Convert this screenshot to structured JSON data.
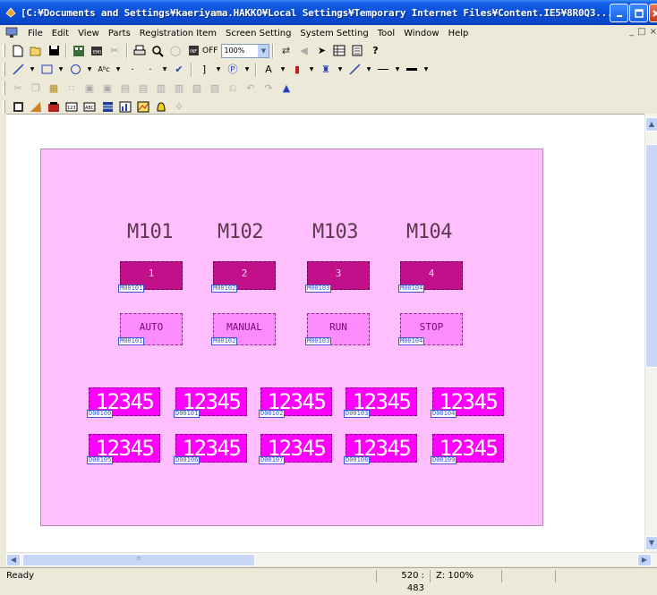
{
  "window": {
    "title": "[C:¥Documents and Settings¥kaeriyama.HAKKO¥Local Settings¥Temporary Internet Files¥Content.IE5¥8R0Q3..."
  },
  "menu": [
    "File",
    "Edit",
    "View",
    "Parts",
    "Registration Item",
    "Screen Setting",
    "System Setting",
    "Tool",
    "Window",
    "Help"
  ],
  "toolbar": {
    "grid_state": "OFF",
    "zoom_value": "100%"
  },
  "screen": {
    "bit_labels": [
      "M101",
      "M102",
      "M103",
      "M104"
    ],
    "lamps": [
      {
        "text": "1",
        "tag": "M00101"
      },
      {
        "text": "2",
        "tag": "M00102"
      },
      {
        "text": "3",
        "tag": "M00103"
      },
      {
        "text": "4",
        "tag": "M00104"
      }
    ],
    "switches": [
      {
        "text": "AUTO",
        "tag": "M00101"
      },
      {
        "text": "MANUAL",
        "tag": "M00102"
      },
      {
        "text": "RUN",
        "tag": "M00103"
      },
      {
        "text": "STOP",
        "tag": "M00104"
      }
    ],
    "numerals_row1": [
      {
        "value": "12345",
        "tag": "D00100"
      },
      {
        "value": "12345",
        "tag": "D00101"
      },
      {
        "value": "12345",
        "tag": "D00102"
      },
      {
        "value": "12345",
        "tag": "D00103"
      },
      {
        "value": "12345",
        "tag": "D00104"
      }
    ],
    "numerals_row2": [
      {
        "value": "12345",
        "tag": "D00105"
      },
      {
        "value": "12345",
        "tag": "D00106"
      },
      {
        "value": "12345",
        "tag": "D00107"
      },
      {
        "value": "12345",
        "tag": "D00108"
      },
      {
        "value": "12345",
        "tag": "D00109"
      }
    ]
  },
  "status": {
    "message": "Ready",
    "cursor": "520 : 483",
    "zoom": "Z: 100%"
  },
  "colors": {
    "screen_bg": "#ffbfff",
    "lamp": "#c2108a",
    "switch": "#ff8cff",
    "numeral": "#ff00ff"
  }
}
